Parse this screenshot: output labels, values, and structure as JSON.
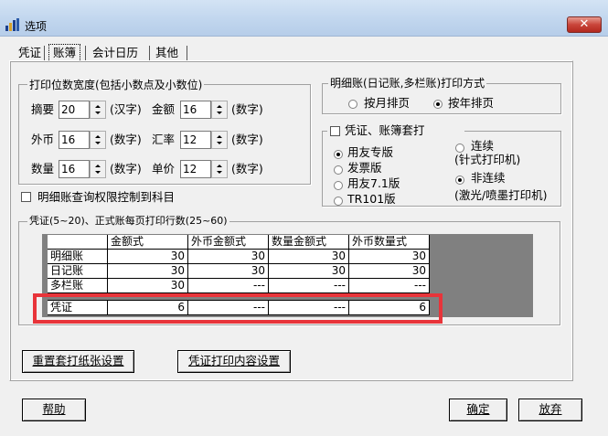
{
  "window": {
    "title": "选项",
    "close_glyph": "✕"
  },
  "tabs": [
    {
      "label": "凭证",
      "selected": false
    },
    {
      "label": "账簿",
      "selected": true
    },
    {
      "label": "会计日历",
      "selected": false
    },
    {
      "label": "其他",
      "selected": false
    }
  ],
  "print_width": {
    "title": "打印位数宽度(包括小数点及小数位)",
    "rows": [
      {
        "left_label": "摘要",
        "left_value": "20",
        "left_unit": "(汉字)",
        "right_label": "金额",
        "right_value": "16",
        "right_unit": "(数字)"
      },
      {
        "left_label": "外币",
        "left_value": "16",
        "left_unit": "(数字)",
        "right_label": "汇率",
        "right_value": "12",
        "right_unit": "(数字)"
      },
      {
        "left_label": "数量",
        "left_value": "16",
        "left_unit": "(数字)",
        "right_label": "单价",
        "right_value": "12",
        "right_unit": "(数字)"
      }
    ]
  },
  "detail_print": {
    "title": "明细账(日记账,多栏账)打印方式",
    "options": [
      {
        "label": "按月排页",
        "selected": false
      },
      {
        "label": "按年排页",
        "selected": true
      }
    ]
  },
  "template_print": {
    "title": "凭证、账簿套打",
    "checked": false,
    "versions": [
      {
        "label": "用友专版",
        "selected": true
      },
      {
        "label": "发票版",
        "selected": false
      },
      {
        "label": "用友7.1版",
        "selected": false
      },
      {
        "label": "TR101版",
        "selected": false
      }
    ],
    "printer_types": [
      {
        "label": "连续",
        "sub": "(针式打印机)",
        "selected": false
      },
      {
        "label": "非连续",
        "sub": "(激光/喷墨打印机)",
        "selected": true
      }
    ]
  },
  "permission_check": {
    "label": "明细账查询权限控制到科目",
    "checked": false
  },
  "row_count": {
    "title": "凭证(5~20)、正式账每页打印行数(25~60)",
    "headers": [
      "金额式",
      "外币金额式",
      "数量金额式",
      "外币数量式"
    ],
    "rows": [
      {
        "name": "明细账",
        "values": [
          "30",
          "30",
          "30",
          "30"
        ]
      },
      {
        "name": "日记账",
        "values": [
          "30",
          "30",
          "30",
          "30"
        ]
      },
      {
        "name": "多栏账",
        "values": [
          "30",
          "---",
          "---",
          "---"
        ]
      },
      {
        "name": "凭证",
        "values": [
          "6",
          "---",
          "---",
          "6"
        ]
      }
    ]
  },
  "buttons": {
    "paper_setup": "重置套打纸张设置",
    "voucher_print": "凭证打印内容设置",
    "help": "帮助",
    "ok": "确定",
    "cancel": "放弃"
  },
  "colors": {
    "highlight_box": "#e8343a",
    "titlebar": "#c1d6ee",
    "close_button": "#c9453a"
  }
}
